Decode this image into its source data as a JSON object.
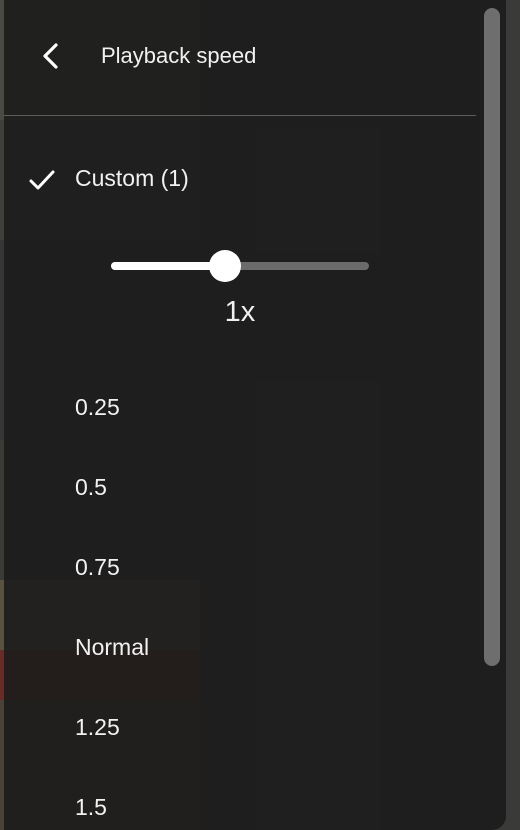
{
  "menu": {
    "title": "Playback speed",
    "back_icon": "chevron-left-icon"
  },
  "custom": {
    "label": "Custom (1)",
    "selected": true,
    "check_icon": "check-icon"
  },
  "slider": {
    "readout": "1x",
    "level": 0.44
  },
  "options": [
    {
      "label": "0.25"
    },
    {
      "label": "0.5"
    },
    {
      "label": "0.75"
    },
    {
      "label": "Normal"
    },
    {
      "label": "1.25"
    },
    {
      "label": "1.5"
    }
  ],
  "colors": {
    "panel_bg": "#1c1c1c",
    "text": "#f1f1f1",
    "slider_fill": "#ffffff",
    "slider_track": "#6b6b6b"
  }
}
